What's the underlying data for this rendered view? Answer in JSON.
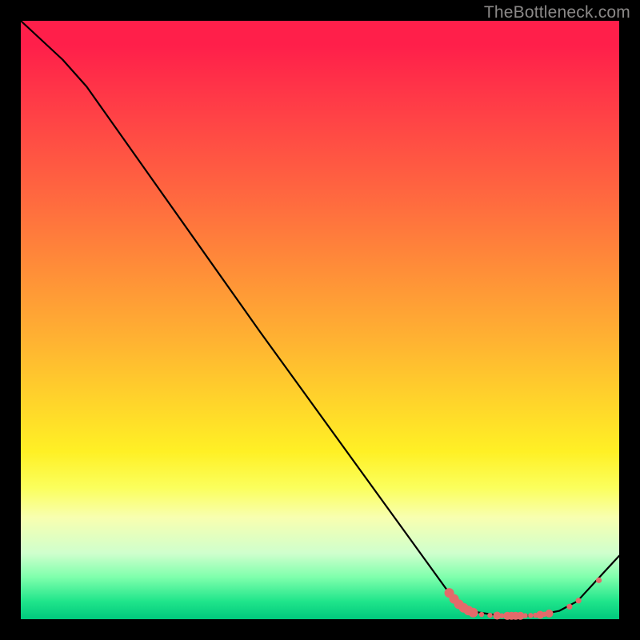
{
  "watermark": "TheBottleneck.com",
  "chart_data": {
    "type": "line",
    "title": "",
    "xlabel": "",
    "ylabel": "",
    "xlim": [
      0,
      100
    ],
    "ylim": [
      0,
      100
    ],
    "curve": [
      {
        "x": 0,
        "y": 100
      },
      {
        "x": 7,
        "y": 93.5
      },
      {
        "x": 11,
        "y": 89
      },
      {
        "x": 40,
        "y": 48
      },
      {
        "x": 71.5,
        "y": 4.5
      },
      {
        "x": 74,
        "y": 2.2
      },
      {
        "x": 76,
        "y": 1.2
      },
      {
        "x": 80,
        "y": 0.6
      },
      {
        "x": 86,
        "y": 0.6
      },
      {
        "x": 90,
        "y": 1.4
      },
      {
        "x": 93,
        "y": 3.0
      },
      {
        "x": 100,
        "y": 10.6
      }
    ],
    "markers": [
      {
        "x": 71.6,
        "y": 4.4,
        "r": 6
      },
      {
        "x": 72.4,
        "y": 3.4,
        "r": 6
      },
      {
        "x": 73.2,
        "y": 2.5,
        "r": 6
      },
      {
        "x": 74.0,
        "y": 1.9,
        "r": 6
      },
      {
        "x": 74.8,
        "y": 1.45,
        "r": 6
      },
      {
        "x": 75.6,
        "y": 1.1,
        "r": 6
      },
      {
        "x": 77.0,
        "y": 0.8,
        "r": 3.2
      },
      {
        "x": 78.4,
        "y": 0.65,
        "r": 3.2
      },
      {
        "x": 79.6,
        "y": 0.6,
        "r": 5
      },
      {
        "x": 80.4,
        "y": 0.58,
        "r": 3.2
      },
      {
        "x": 81.3,
        "y": 0.56,
        "r": 5
      },
      {
        "x": 82.0,
        "y": 0.56,
        "r": 5
      },
      {
        "x": 82.7,
        "y": 0.56,
        "r": 5
      },
      {
        "x": 83.5,
        "y": 0.57,
        "r": 5
      },
      {
        "x": 84.3,
        "y": 0.59,
        "r": 3.2
      },
      {
        "x": 85.2,
        "y": 0.62,
        "r": 3.2
      },
      {
        "x": 86.0,
        "y": 0.66,
        "r": 3.2
      },
      {
        "x": 86.8,
        "y": 0.73,
        "r": 5
      },
      {
        "x": 87.5,
        "y": 0.82,
        "r": 3.2
      },
      {
        "x": 88.3,
        "y": 0.95,
        "r": 5
      },
      {
        "x": 91.7,
        "y": 2.1,
        "r": 3.6
      },
      {
        "x": 93.2,
        "y": 3.1,
        "r": 3.6
      },
      {
        "x": 96.6,
        "y": 6.5,
        "r": 3.6
      }
    ]
  }
}
